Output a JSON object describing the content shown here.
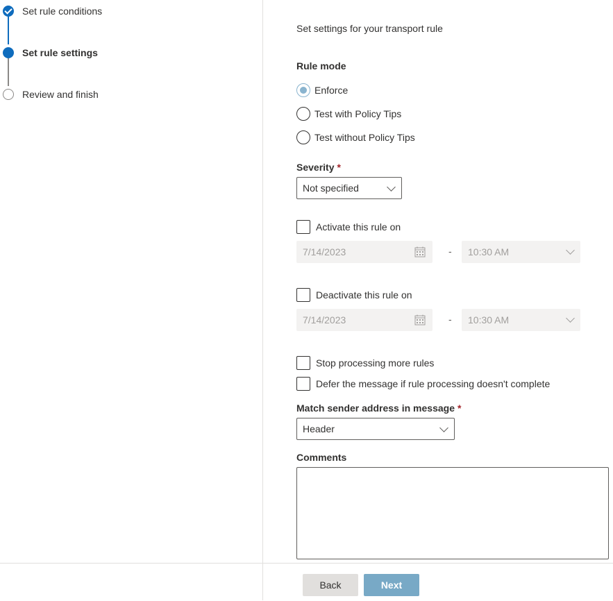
{
  "steps": [
    {
      "label": "Set rule conditions",
      "state": "done"
    },
    {
      "label": "Set rule settings",
      "state": "current"
    },
    {
      "label": "Review and finish",
      "state": "todo"
    }
  ],
  "colors": {
    "accent": "#0f6cbd",
    "line_inactive": "#8a8886",
    "required": "#a4262c",
    "next_button": "#78a9c6"
  },
  "main": {
    "intro": "Set settings for your transport rule",
    "rule_mode": {
      "label": "Rule mode",
      "options": [
        "Enforce",
        "Test with Policy Tips",
        "Test without Policy Tips"
      ],
      "selected": "Enforce"
    },
    "severity": {
      "label": "Severity",
      "required_mark": "*",
      "value": "Not specified"
    },
    "activate": {
      "label": "Activate this rule on",
      "checked": false,
      "date": "7/14/2023",
      "dash": "-",
      "time": "10:30 AM"
    },
    "deactivate": {
      "label": "Deactivate this rule on",
      "checked": false,
      "date": "7/14/2023",
      "dash": "-",
      "time": "10:30 AM"
    },
    "stop_processing": {
      "label": "Stop processing more rules",
      "checked": false
    },
    "defer": {
      "label": "Defer the message if rule processing doesn't complete",
      "checked": false
    },
    "match_sender": {
      "label": "Match sender address in message",
      "required_mark": "*",
      "value": "Header"
    },
    "comments": {
      "label": "Comments",
      "value": ""
    }
  },
  "footer": {
    "back_label": "Back",
    "next_label": "Next"
  },
  "icons": {
    "calendar": "calendar-icon",
    "chevron": "chevron-down-icon",
    "check": "checkmark-icon"
  }
}
